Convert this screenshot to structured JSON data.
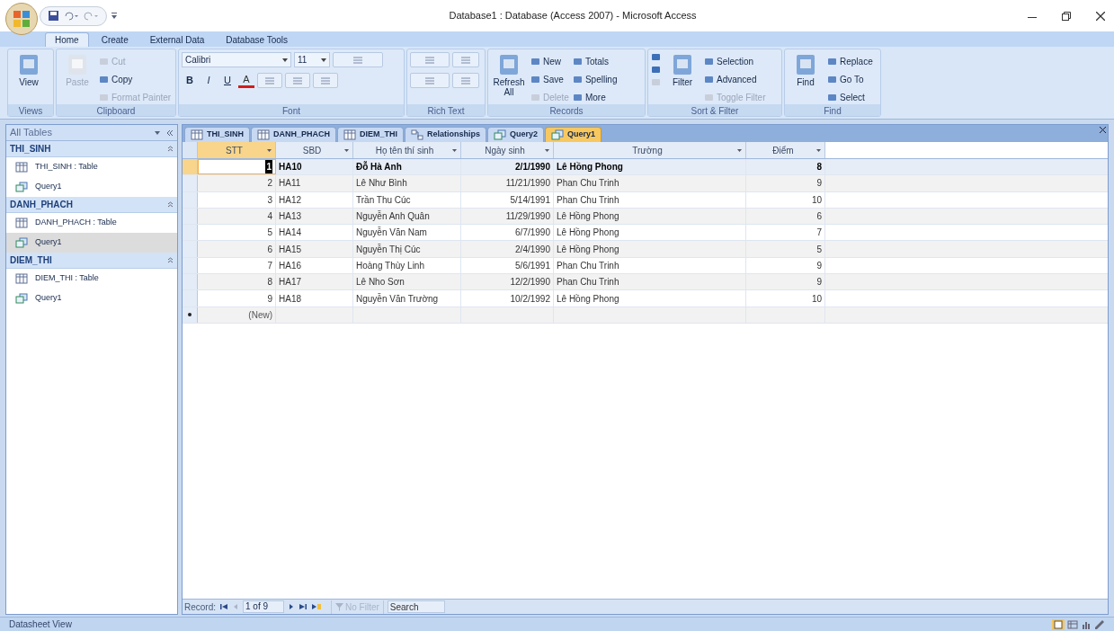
{
  "window": {
    "title": "Database1 : Database (Access 2007) - Microsoft Access"
  },
  "ribbon": {
    "tabs": [
      {
        "label": "Home",
        "selected": true
      },
      {
        "label": "Create",
        "selected": false
      },
      {
        "label": "External Data",
        "selected": false
      },
      {
        "label": "Database Tools",
        "selected": false
      }
    ],
    "groups": [
      {
        "label": "Views",
        "items": [
          {
            "kind": "large",
            "label": "View",
            "disabled": false
          }
        ]
      },
      {
        "label": "Clipboard",
        "items": [
          {
            "kind": "large",
            "label": "Paste",
            "disabled": true
          },
          {
            "kind": "small",
            "label": "Cut",
            "disabled": true
          },
          {
            "kind": "small",
            "label": "Copy",
            "disabled": false
          },
          {
            "kind": "small",
            "label": "Format Painter",
            "disabled": true
          }
        ]
      },
      {
        "label": "Font",
        "items": [
          {
            "kind": "field",
            "value": "Calibri"
          },
          {
            "kind": "field",
            "value": "11"
          },
          {
            "kind": "glyph",
            "label": "B"
          },
          {
            "kind": "glyph",
            "label": "I"
          },
          {
            "kind": "glyph",
            "label": "U"
          },
          {
            "kind": "glyph",
            "label": "A"
          }
        ]
      },
      {
        "label": "Rich Text"
      },
      {
        "label": "Records",
        "items": [
          {
            "kind": "large",
            "label": "Refresh All",
            "disabled": false
          },
          {
            "kind": "small",
            "label": "New",
            "disabled": false
          },
          {
            "kind": "small",
            "label": "Save",
            "disabled": false
          },
          {
            "kind": "small",
            "label": "Delete",
            "disabled": true
          },
          {
            "kind": "small",
            "label": "Totals",
            "disabled": false
          },
          {
            "kind": "small",
            "label": "Spelling",
            "disabled": false
          },
          {
            "kind": "small",
            "label": "More",
            "disabled": false
          }
        ]
      },
      {
        "label": "Sort & Filter",
        "items": [
          {
            "kind": "large",
            "label": "Filter",
            "disabled": false
          },
          {
            "kind": "small",
            "label": "Selection",
            "disabled": false
          },
          {
            "kind": "small",
            "label": "Advanced",
            "disabled": false
          },
          {
            "kind": "small",
            "label": "Toggle Filter",
            "disabled": true
          }
        ]
      },
      {
        "label": "Find",
        "items": [
          {
            "kind": "large",
            "label": "Find",
            "disabled": false
          },
          {
            "kind": "small",
            "label": "Replace",
            "disabled": false
          },
          {
            "kind": "small",
            "label": "Go To",
            "disabled": false
          },
          {
            "kind": "small",
            "label": "Select",
            "disabled": false
          }
        ]
      }
    ]
  },
  "navigation_pane": {
    "title": "All Tables",
    "groups": [
      {
        "label": "THI_SINH",
        "items": [
          {
            "kind": "table",
            "label": "THI_SINH : Table",
            "selected": false
          },
          {
            "kind": "query",
            "label": "Query1",
            "selected": false
          }
        ]
      },
      {
        "label": "DANH_PHACH",
        "items": [
          {
            "kind": "table",
            "label": "DANH_PHACH : Table",
            "selected": false
          },
          {
            "kind": "query",
            "label": "Query1",
            "selected": true
          }
        ]
      },
      {
        "label": "DIEM_THI",
        "items": [
          {
            "kind": "table",
            "label": "DIEM_THI : Table",
            "selected": false
          },
          {
            "kind": "query",
            "label": "Query1",
            "selected": false
          }
        ]
      }
    ]
  },
  "document_tabs": [
    {
      "kind": "table",
      "label": "THI_SINH",
      "selected": false
    },
    {
      "kind": "table",
      "label": "DANH_PHACH",
      "selected": false
    },
    {
      "kind": "table",
      "label": "DIEM_THI",
      "selected": false
    },
    {
      "kind": "relationships",
      "label": "Relationships",
      "selected": false
    },
    {
      "kind": "query",
      "label": "Query2",
      "selected": false
    },
    {
      "kind": "query",
      "label": "Query1",
      "selected": true
    }
  ],
  "datasheet": {
    "columns": [
      "STT",
      "SBD",
      "Họ tên thí sinh",
      "Ngày sinh",
      "Trường",
      "Điểm"
    ],
    "rows": [
      {
        "current": true,
        "cells": [
          "1",
          "HA10",
          "Đỗ Hà Anh",
          "2/1/1990",
          "Lê Hồng Phong",
          "8"
        ]
      },
      {
        "current": false,
        "cells": [
          "2",
          "HA11",
          "Lê Như Bình",
          "11/21/1990",
          "Phan Chu Trinh",
          "9"
        ]
      },
      {
        "current": false,
        "cells": [
          "3",
          "HA12",
          "Trần Thu Cúc",
          "5/14/1991",
          "Phan Chu Trinh",
          "10"
        ]
      },
      {
        "current": false,
        "cells": [
          "4",
          "HA13",
          "Nguyễn Anh Quân",
          "11/29/1990",
          "Lê Hồng Phong",
          "6"
        ]
      },
      {
        "current": false,
        "cells": [
          "5",
          "HA14",
          "Nguyễn Văn Nam",
          "6/7/1990",
          "Lê Hồng Phong",
          "7"
        ]
      },
      {
        "current": false,
        "cells": [
          "6",
          "HA15",
          "Nguyễn Thị Cúc",
          "2/4/1990",
          "Lê Hồng Phong",
          "5"
        ]
      },
      {
        "current": false,
        "cells": [
          "7",
          "HA16",
          "Hoàng Thùy Linh",
          "5/6/1991",
          "Phan Chu Trinh",
          "9"
        ]
      },
      {
        "current": false,
        "cells": [
          "8",
          "HA17",
          "Lê Nho Sơn",
          "12/2/1990",
          "Phan Chu Trinh",
          "9"
        ]
      },
      {
        "current": false,
        "cells": [
          "9",
          "HA18",
          "Nguyễn Văn Trường",
          "10/2/1992",
          "Lê Hồng Phong",
          "10"
        ]
      }
    ],
    "new_row": "(New)"
  },
  "record_navigator": {
    "label": "Record:",
    "position": "1 of 9",
    "filter": "No Filter",
    "filter_disabled": true,
    "search_placeholder": "Search"
  },
  "status_bar": {
    "text": "Datasheet View"
  }
}
